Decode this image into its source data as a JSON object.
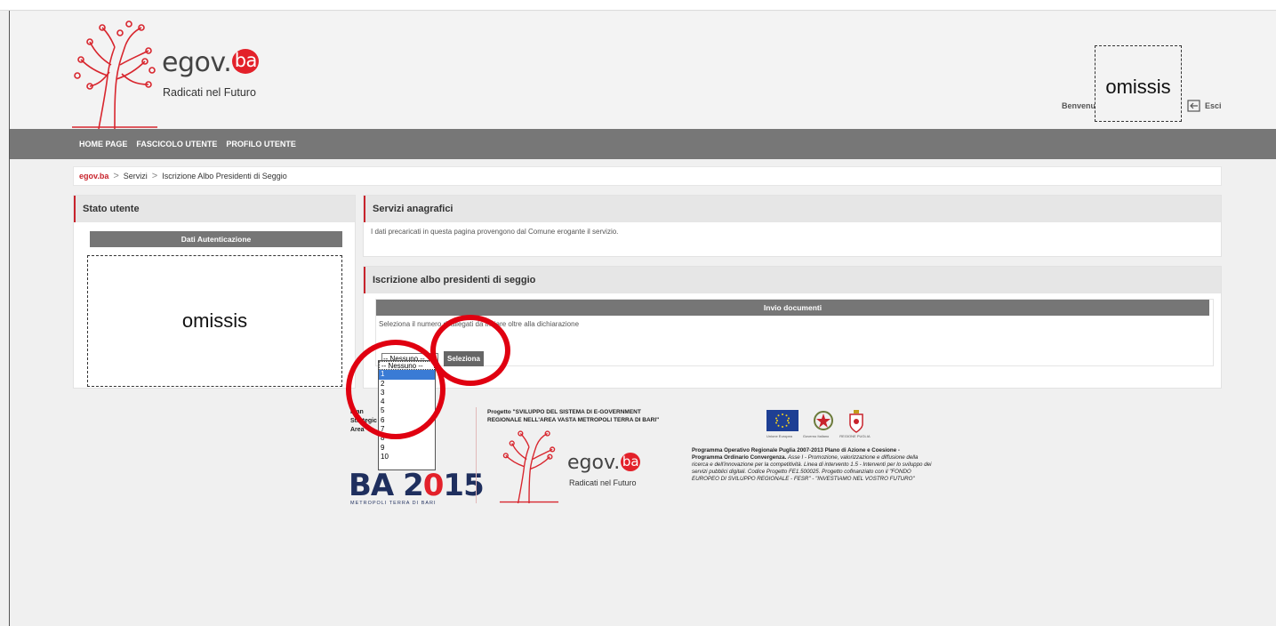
{
  "header": {
    "logo_main": "egov.",
    "logo_ba": "ba",
    "logo_tagline": "Radicati nel Futuro",
    "welcome": "Benvenut",
    "redacted": "omissis",
    "logout_label": "Esci"
  },
  "nav": {
    "items": [
      {
        "label": "HOME PAGE"
      },
      {
        "label": "FASCICOLO UTENTE"
      },
      {
        "label": "PROFILO UTENTE"
      }
    ]
  },
  "breadcrumb": {
    "home": "egov.ba",
    "items": [
      "Servizi",
      "Iscrizione Albo Presidenti di Seggio"
    ]
  },
  "stato_utente": {
    "title": "Stato utente",
    "subbar": "Dati Autenticazione",
    "redacted": "omissis"
  },
  "servizi": {
    "title": "Servizi anagrafici",
    "description": "I dati precaricati in questa pagina provengono dal Comune erogante il servizio."
  },
  "iscrizione": {
    "title": "Iscrizione albo presidenti di seggio",
    "subbar": "Invio documenti",
    "select_text": "Seleziona il numero di allegati da inviare oltre alla dichiarazione",
    "select_value": "-- Nessuno --",
    "button": "Seleziona",
    "options": [
      "-- Nessuno --",
      "1",
      "2",
      "3",
      "4",
      "5",
      "6",
      "7",
      "8",
      "9",
      "10"
    ],
    "highlighted_option": "1"
  },
  "footer": {
    "left_text": [
      "Pian",
      "Strategic",
      "Area"
    ],
    "ba2015_ba": "BA",
    "ba2015_2": "2",
    "ba2015_o": "0",
    "ba2015_15": "15",
    "ba2015_sub": "METROPOLI TERRA DI BARI",
    "project_title_1": "Progetto \"SVILUPPO DEL SISTEMA DI E-GOVERNMENT",
    "project_title_2": "REGIONALE NELL'AREA VASTA METROPOLI TERRA DI BARI\"",
    "logo_main": "egov.",
    "logo_ba": "ba",
    "logo_tagline": "Radicati nel Futuro",
    "logo_captions": [
      "Unione Europea",
      "Governo Italiano",
      "REGIONE PUGLIA"
    ],
    "program_bold": "Programma Operativo Regionale Puglia 2007-2013 Plano di Azione e Coesione - Programma Ordinario Convergenza.",
    "program_italic": "Asse I - Promozione, valorizzazione e diffusione della ricerca e dell'innovazione per la competitività. Linea di intervento 1.5 - Interventi per lo sviluppo dei servizi pubblici digitali. Codice Progetto FE1.500025. Progetto cofinanziato con il \"FONDO EUROPEO DI SVILUPPO REGIONALE - FESR\" - \"INVESTIAMO NEL VOSTRO FUTURO\""
  },
  "colors": {
    "brand_red": "#e3212a",
    "nav_gray": "#777777",
    "annotation_red": "#e00010",
    "ba2015_blue": "#1f2f5e"
  }
}
